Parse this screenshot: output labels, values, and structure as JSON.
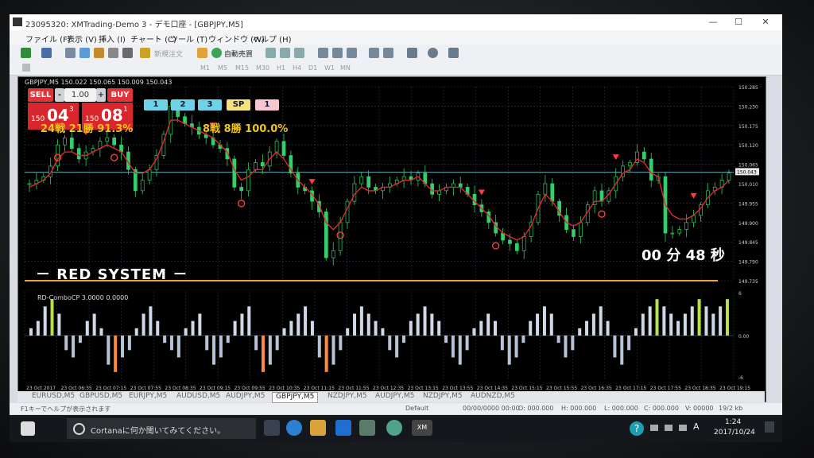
{
  "window": {
    "title": "23095320: XMTrading-Demo 3 - デモ口座 - [GBPJPY,M5]",
    "minimize": "—",
    "maximize": "☐",
    "close": "✕"
  },
  "menu": {
    "items": [
      "ファイル (F)",
      "表示 (V)",
      "挿入 (I)",
      "チャート (C)",
      "ツール (T)",
      "ウィンドウ (W)",
      "ヘルプ (H)"
    ]
  },
  "toolbar": {
    "new_order": "新規注文",
    "auto_trade": "自動売買",
    "timeframes": [
      "M1",
      "M5",
      "M15",
      "M30",
      "H1",
      "H4",
      "D1",
      "W1",
      "MN"
    ]
  },
  "chart": {
    "header": "GBPJPY,M5  150.022 150.065 150.009 150.043",
    "sell_label": "SELL",
    "buy_label": "BUY",
    "lot": "1.00",
    "sell_prefix": "150",
    "sell_big": "04",
    "sell_sup": "3",
    "buy_prefix": "150",
    "buy_big": "08",
    "buy_sup": "1",
    "level_buttons": [
      "1",
      "2",
      "3",
      "SP",
      "1"
    ],
    "stats_left": "24戦 21勝 91.3%",
    "stats_right": "8戦 8勝 100.0%",
    "system_label": "－ RED SYSTEM －",
    "timer": "00 分 48 秒",
    "price_scale": [
      "150.285",
      "150.230",
      "150.175",
      "150.120",
      "150.065",
      "150.010",
      "149.955",
      "149.900",
      "149.845",
      "149.790",
      "149.735"
    ],
    "current_price": "150.043",
    "indicator_title": "RD-ComboCP 3.0000 0.0000",
    "indicator_scale": [
      "6",
      "0.00",
      "-6"
    ],
    "time_labels": [
      "23 Oct 2017",
      "23 Oct 06:35",
      "23 Oct 07:15",
      "23 Oct 07:55",
      "23 Oct 08:35",
      "23 Oct 09:15",
      "23 Oct 09:55",
      "23 Oct 10:35",
      "23 Oct 11:15",
      "23 Oct 11:55",
      "23 Oct 12:35",
      "23 Oct 13:15",
      "23 Oct 13:55",
      "23 Oct 14:35",
      "23 Oct 15:15",
      "23 Oct 15:55",
      "23 Oct 16:35",
      "23 Oct 17:15",
      "23 Oct 17:55",
      "23 Oct 18:35",
      "23 Oct 19:15"
    ]
  },
  "chart_data": {
    "type": "line",
    "price_close": [
      150.01,
      150.02,
      150.03,
      150.06,
      150.12,
      150.14,
      150.11,
      150.08,
      150.1,
      150.11,
      150.13,
      150.14,
      150.12,
      150.1,
      150.05,
      149.99,
      150.02,
      150.05,
      150.09,
      150.15,
      150.23,
      150.2,
      150.18,
      150.17,
      150.15,
      150.14,
      150.12,
      150.11,
      150.08,
      150.0,
      149.99,
      150.05,
      150.07,
      150.06,
      150.1,
      150.13,
      150.09,
      150.04,
      150.0,
      149.99,
      149.96,
      149.93,
      149.8,
      149.82,
      149.9,
      149.96,
      150.01,
      150.03,
      150.0,
      149.99,
      150.0,
      150.01,
      150.02,
      150.03,
      150.02,
      150.04,
      150.01,
      149.98,
      149.99,
      150.0,
      150.01,
      150.0,
      149.98,
      149.95,
      149.93,
      149.9,
      149.87,
      149.85,
      149.84,
      149.82,
      149.86,
      149.9,
      149.98,
      150.01,
      149.96,
      149.92,
      149.88,
      149.86,
      149.9,
      149.95,
      149.99,
      149.96,
      149.99,
      150.03,
      150.06,
      150.07,
      150.1,
      150.08,
      150.02,
      150.03,
      149.87,
      149.87,
      149.88,
      149.9,
      149.92,
      149.95,
      149.99,
      150.0,
      150.02,
      150.04
    ],
    "moving_average": [
      150.0,
      150.01,
      150.02,
      150.04,
      150.08,
      150.1,
      150.1,
      150.09,
      150.09,
      150.1,
      150.11,
      150.12,
      150.11,
      150.1,
      150.07,
      150.04,
      150.04,
      150.05,
      150.08,
      150.13,
      150.19,
      150.19,
      150.18,
      150.17,
      150.16,
      150.15,
      150.14,
      150.12,
      150.1,
      150.05,
      150.02,
      150.03,
      150.05,
      150.05,
      150.08,
      150.1,
      150.08,
      150.05,
      150.02,
      150.0,
      149.98,
      149.95,
      149.9,
      149.88,
      149.9,
      149.94,
      149.98,
      150.0,
      149.99,
      149.99,
      150.0,
      150.0,
      150.01,
      150.02,
      150.02,
      150.03,
      150.01,
      149.99,
      149.99,
      150.0,
      150.0,
      150.0,
      149.98,
      149.96,
      149.94,
      149.92,
      149.89,
      149.87,
      149.86,
      149.85,
      149.86,
      149.89,
      149.94,
      149.98,
      149.96,
      149.93,
      149.9,
      149.89,
      149.9,
      149.93,
      149.96,
      149.96,
      149.98,
      150.01,
      150.04,
      150.05,
      150.08,
      150.07,
      150.04,
      150.03,
      149.95,
      149.92,
      149.91,
      149.91,
      149.92,
      149.94,
      149.97,
      149.99,
      150.0,
      150.02
    ],
    "indicator": [
      1,
      2,
      4,
      5,
      3,
      -2,
      -3,
      -1,
      2,
      3,
      1,
      -4,
      -5,
      -3,
      -2,
      1,
      3,
      4,
      2,
      -1,
      -2,
      -3,
      1,
      2,
      3,
      -2,
      -4,
      -3,
      -1,
      2,
      3,
      4,
      -2,
      -5,
      -4,
      -2,
      1,
      2,
      3,
      4,
      2,
      -3,
      -5,
      -4,
      -2,
      1,
      3,
      4,
      3,
      2,
      1,
      -2,
      -3,
      -1,
      2,
      3,
      4,
      3,
      2,
      -1,
      -3,
      -4,
      -2,
      1,
      2,
      3,
      2,
      -2,
      -4,
      -3,
      -1,
      2,
      3,
      4,
      3,
      -1,
      -3,
      -2,
      1,
      2,
      3,
      4,
      2,
      -3,
      -4,
      -2,
      1,
      3,
      4,
      5,
      4,
      3,
      2,
      3,
      4,
      5,
      4,
      3,
      4,
      5
    ],
    "ylim": [
      149.735,
      150.285
    ]
  },
  "tabs": {
    "items": [
      "EURUSD,M5",
      "GBPUSD,M5",
      "EURJPY,M5",
      "AUDUSD,M5",
      "AUDJPY,M5",
      "GBPJPY,M5",
      "NZDJPY,M5",
      "AUDJPY,M5",
      "NZDJPY,M5",
      "AUDNZD,M5"
    ],
    "active_index": 5
  },
  "status": {
    "help": "F1キーでヘルプが表示されます",
    "profile": "Default",
    "timestamp": "00/00/0000 00:00",
    "open": "O: 000.000",
    "high": "H: 000.000",
    "low": "L: 000.000",
    "close": "C: 000.000",
    "volume": "V: 00000",
    "traffic": "19/2 kb"
  },
  "taskbar": {
    "search_placeholder": "Cortanaに何か聞いてみてください。",
    "time": "1:24",
    "date": "2017/10/24",
    "ime": "A"
  }
}
